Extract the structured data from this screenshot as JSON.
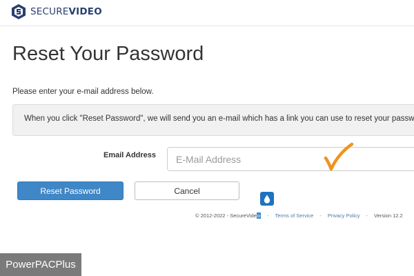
{
  "header": {
    "logo_text_light": "SECURE",
    "logo_text_bold": "VIDEO",
    "logo_icon": "securevideo-shield-logo"
  },
  "main": {
    "title": "Reset Your Password",
    "instruction": "Please enter your e-mail address below.",
    "info_message": "When you click \"Reset Password\", we will send you an e-mail which has a link you can use to reset your password."
  },
  "form": {
    "email_label": "Email Address",
    "email_placeholder": "E-Mail Address",
    "email_value": "",
    "reset_button_label": "Reset Password",
    "cancel_button_label": "Cancel"
  },
  "footer": {
    "copyright_prefix": "© 2012-2022 - SecureVide",
    "copyright_cursor_char": "o",
    "separator": "-",
    "terms_label": "Terms of Service",
    "privacy_label": "Privacy Policy",
    "version_label": "Version 12.2"
  },
  "overlay": {
    "checkmark_icon": "orange-checkmark",
    "checkmark_color": "#f0931e",
    "drop_icon": "water-drop-icon",
    "watermark_text": "PowerPACPlus"
  },
  "colors": {
    "brand_navy": "#2a3e6e",
    "primary_button": "#3f87c6",
    "info_box_bg": "#f1f1f1"
  }
}
